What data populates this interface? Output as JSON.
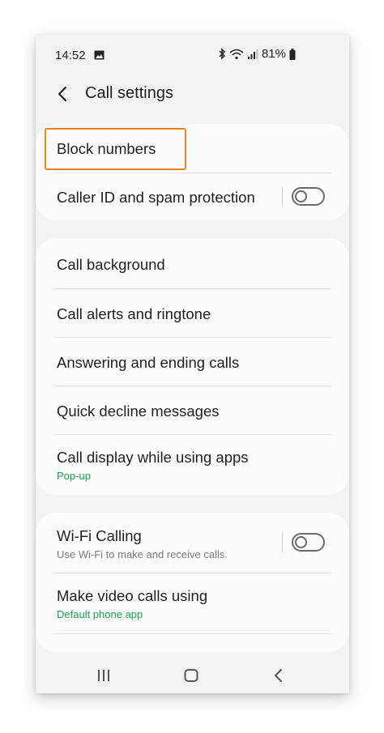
{
  "status_bar": {
    "time": "14:52",
    "battery": "81%",
    "icons": [
      "gallery-icon",
      "bluetooth-icon",
      "wifi-icon",
      "signal-icon",
      "battery-icon"
    ]
  },
  "header": {
    "title": "Call settings",
    "back_icon": "chevron-left-icon"
  },
  "group1": {
    "block_numbers": "Block numbers",
    "caller_id": "Caller ID and spam protection"
  },
  "group2": {
    "items": [
      "Call background",
      "Call alerts and ringtone",
      "Answering and ending calls",
      "Quick decline messages"
    ],
    "call_display": {
      "label": "Call display while using apps",
      "value": "Pop-up"
    }
  },
  "group3": {
    "wifi_calling": {
      "label": "Wi-Fi Calling",
      "description": "Use Wi-Fi to make and receive calls."
    },
    "video_calls": {
      "label": "Make video calls using",
      "value": "Default phone app"
    }
  },
  "colors": {
    "highlight": "#f0821e",
    "accent_green": "#16a34a",
    "card_bg": "#fcfcfc",
    "screen_bg": "#f3f3f3"
  },
  "toggles": {
    "caller_id_enabled": false,
    "wifi_calling_enabled": false
  },
  "navbar": {
    "icons": [
      "recents-icon",
      "home-icon",
      "back-icon"
    ]
  }
}
